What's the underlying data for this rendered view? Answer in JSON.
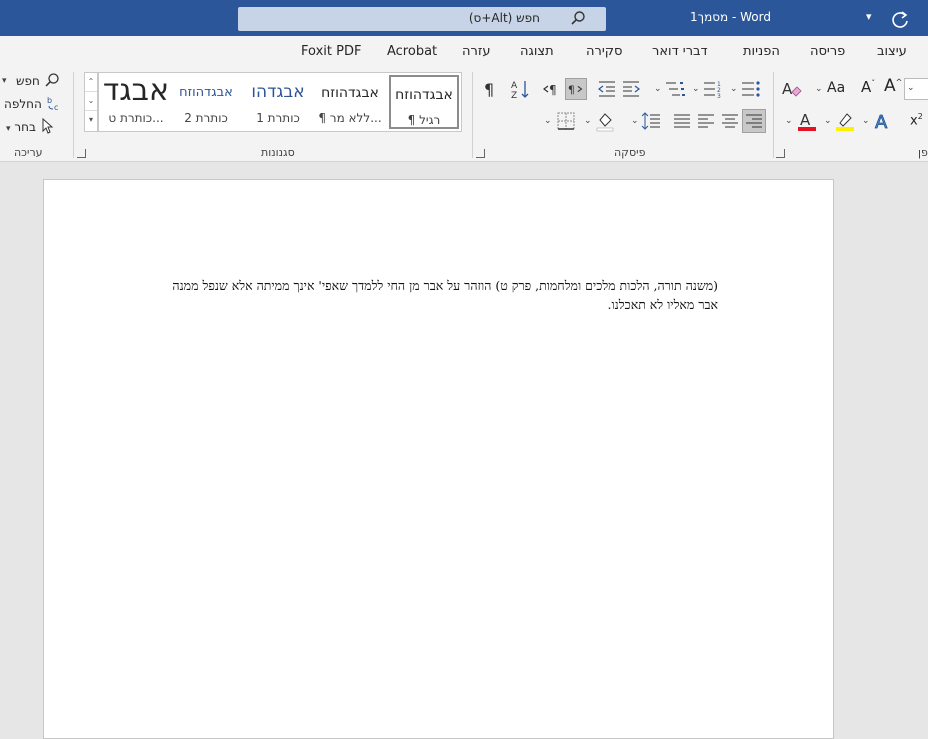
{
  "titlebar": {
    "search_text": "חפש (Alt+ס)",
    "doc_title": "מסמך1  -  Word",
    "accent": "#2b579a"
  },
  "tabs": [
    "עיצוב",
    "פריסה",
    "הפניות",
    "דברי דואר",
    "סקירה",
    "תצוגה",
    "עזרה",
    "Acrobat",
    "Foxit PDF"
  ],
  "ribbon": {
    "editing": {
      "label": "עריכה",
      "find": "חפש",
      "replace": "החלפה",
      "select": "בחר"
    },
    "styles": {
      "label": "סגנונות",
      "items": [
        {
          "preview": "אבגדהוזח",
          "name": "¶ רגיל"
        },
        {
          "preview": "אבגדהוזח",
          "name": "¶ ללא מר..."
        },
        {
          "preview": "אבגדהו",
          "name": "כותרת 1"
        },
        {
          "preview": "אבגדהוזח",
          "name": "כותרת 2"
        },
        {
          "preview": "אבגד",
          "name": "כותרת ט..."
        }
      ]
    },
    "paragraph": {
      "label": "פיסקה"
    },
    "font": {
      "label_partial": "פן"
    }
  },
  "document": {
    "text": "(משנה תורה, הלכות מלכים ומלחמות, פרק ט) הוזהר על אבר מן החי ללמדך שאפי' אינך ממיתה אלא שנפל ממנה אבר מאליו לא תאכלנו."
  }
}
